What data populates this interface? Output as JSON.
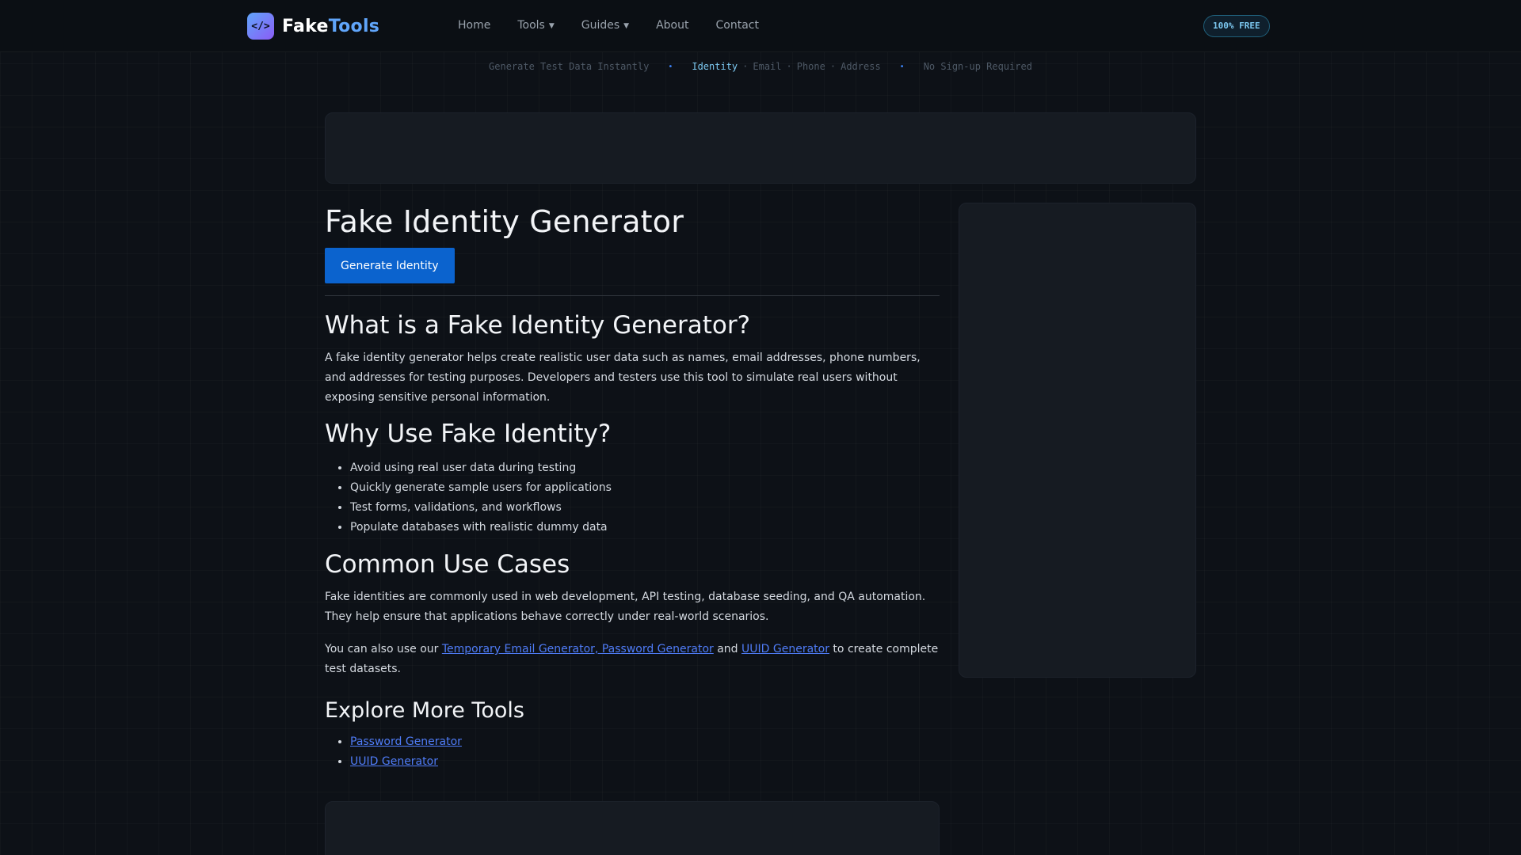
{
  "nav": {
    "logo_icon": "</>",
    "logo_fake": "Fake",
    "logo_tools": "Tools",
    "links": [
      {
        "label": "Home"
      },
      {
        "label": "Tools",
        "dropdown": true
      },
      {
        "label": "Guides",
        "dropdown": true
      },
      {
        "label": "About"
      },
      {
        "label": "Contact"
      }
    ],
    "badge": "100% FREE"
  },
  "ticker": {
    "item1": "Generate Test Data Instantly",
    "active": "Identity",
    "sep": "·",
    "email": "Email",
    "phone": "Phone",
    "address": "Address",
    "item3": "No Sign-up Required",
    "dot": "•"
  },
  "main": {
    "title": "Fake Identity Generator",
    "generate_button": "Generate Identity",
    "section1": {
      "heading": "What is a Fake Identity Generator?",
      "text": "A fake identity generator helps create realistic user data such as names, email addresses, phone numbers, and addresses for testing purposes. Developers and testers use this tool to simulate real users without exposing sensitive personal information."
    },
    "section2": {
      "heading": "Why Use Fake Identity?",
      "items": [
        "Avoid using real user data during testing",
        "Quickly generate sample users for applications",
        "Test forms, validations, and workflows",
        "Populate databases with realistic dummy data"
      ]
    },
    "section3": {
      "heading": "Common Use Cases",
      "text": "Fake identities are commonly used in web development, API testing, database seeding, and QA automation. They help ensure that applications behave correctly under real-world scenarios.",
      "also_prefix": "You can also use our ",
      "link1": "Temporary Email Generator, Password Generator",
      "also_and": " and ",
      "link2": "UUID Generator",
      "also_suffix": " to create complete test datasets."
    },
    "section4": {
      "heading": "Explore More Tools",
      "links": [
        "Password Generator",
        "UUID Generator"
      ]
    }
  },
  "colors": {
    "background": "#0d1117",
    "accent": "#60a5fa",
    "button": "#0b63ce",
    "link": "#4f7cf7"
  },
  "icons": {
    "logo": "code-brackets-icon",
    "caret": "caret-down-icon"
  }
}
